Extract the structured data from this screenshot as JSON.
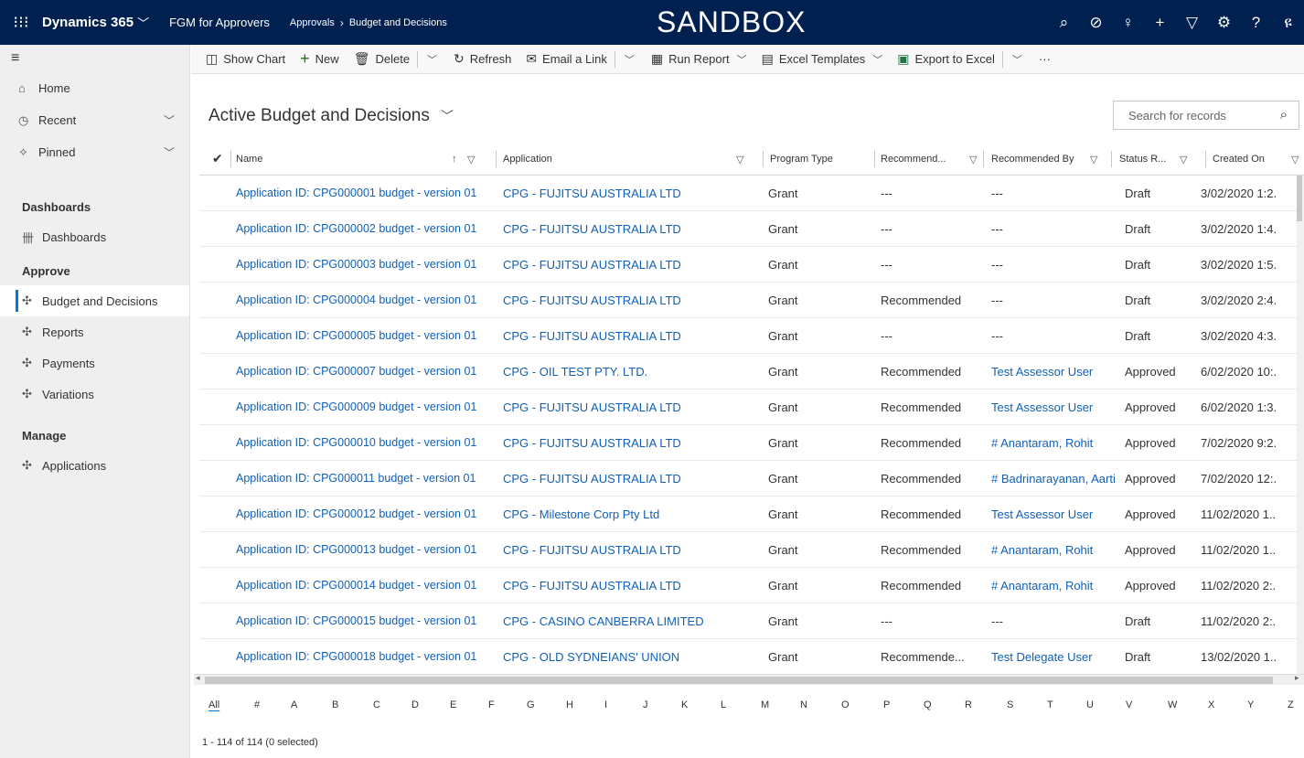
{
  "topbar": {
    "brand": "Dynamics 365",
    "app_name": "FGM for Approvers",
    "breadcrumb_parent": "Approvals",
    "breadcrumb_current": "Budget and Decisions",
    "environment": "SANDBOX"
  },
  "nav": {
    "home": "Home",
    "recent": "Recent",
    "pinned": "Pinned",
    "section_dashboards": "Dashboards",
    "dashboards": "Dashboards",
    "section_approve": "Approve",
    "budget_and_decisions": "Budget and Decisions",
    "reports": "Reports",
    "payments": "Payments",
    "variations": "Variations",
    "section_manage": "Manage",
    "applications": "Applications"
  },
  "commands": {
    "show_chart": "Show Chart",
    "new": "New",
    "delete": "Delete",
    "refresh": "Refresh",
    "email_link": "Email a Link",
    "run_report": "Run Report",
    "excel_templates": "Excel Templates",
    "export_excel": "Export to Excel",
    "more": "···"
  },
  "view": {
    "title": "Active Budget and Decisions",
    "search_placeholder": "Search for records"
  },
  "columns": {
    "name": "Name",
    "application": "Application",
    "program_type": "Program Type",
    "recommend": "Recommend...",
    "recommended_by": "Recommended By",
    "status": "Status R...",
    "created_on": "Created On"
  },
  "rows": [
    {
      "name": "Application ID: CPG000001 budget - version 01",
      "application": "CPG - FUJITSU AUSTRALIA LTD",
      "program_type": "Grant",
      "recommendation": "---",
      "recommended_by": "---",
      "status": "Draft",
      "created_on": "3/02/2020 1:2."
    },
    {
      "name": "Application ID: CPG000002 budget - version 01",
      "application": "CPG - FUJITSU AUSTRALIA LTD",
      "program_type": "Grant",
      "recommendation": "---",
      "recommended_by": "---",
      "status": "Draft",
      "created_on": "3/02/2020 1:4."
    },
    {
      "name": "Application ID: CPG000003 budget - version 01",
      "application": "CPG - FUJITSU AUSTRALIA LTD",
      "program_type": "Grant",
      "recommendation": "---",
      "recommended_by": "---",
      "status": "Draft",
      "created_on": "3/02/2020 1:5."
    },
    {
      "name": "Application ID: CPG000004 budget - version 01",
      "application": "CPG - FUJITSU AUSTRALIA LTD",
      "program_type": "Grant",
      "recommendation": "Recommended",
      "recommended_by": "---",
      "status": "Draft",
      "created_on": "3/02/2020 2:4."
    },
    {
      "name": "Application ID: CPG000005 budget - version 01",
      "application": "CPG - FUJITSU AUSTRALIA LTD",
      "program_type": "Grant",
      "recommendation": "---",
      "recommended_by": "---",
      "status": "Draft",
      "created_on": "3/02/2020 4:3."
    },
    {
      "name": "Application ID: CPG000007 budget - version 01",
      "application": "CPG - OIL TEST PTY. LTD.",
      "program_type": "Grant",
      "recommendation": "Recommended",
      "recommended_by": "Test Assessor User",
      "status": "Approved",
      "created_on": "6/02/2020 10:."
    },
    {
      "name": "Application ID: CPG000009 budget - version 01",
      "application": "CPG - FUJITSU AUSTRALIA LTD",
      "program_type": "Grant",
      "recommendation": "Recommended",
      "recommended_by": "Test Assessor User",
      "status": "Approved",
      "created_on": "6/02/2020 1:3."
    },
    {
      "name": "Application ID: CPG000010 budget - version 01",
      "application": "CPG - FUJITSU AUSTRALIA LTD",
      "program_type": "Grant",
      "recommendation": "Recommended",
      "recommended_by": "# Anantaram, Rohit",
      "status": "Approved",
      "created_on": "7/02/2020 9:2."
    },
    {
      "name": "Application ID: CPG000011 budget - version 01",
      "application": "CPG - FUJITSU AUSTRALIA LTD",
      "program_type": "Grant",
      "recommendation": "Recommended",
      "recommended_by": "# Badrinarayanan, Aarti",
      "status": "Approved",
      "created_on": "7/02/2020 12:."
    },
    {
      "name": "Application ID: CPG000012 budget - version 01",
      "application": "CPG - Milestone Corp Pty Ltd",
      "program_type": "Grant",
      "recommendation": "Recommended",
      "recommended_by": "Test Assessor User",
      "status": "Approved",
      "created_on": "11/02/2020 1.."
    },
    {
      "name": "Application ID: CPG000013 budget - version 01",
      "application": "CPG - FUJITSU AUSTRALIA LTD",
      "program_type": "Grant",
      "recommendation": "Recommended",
      "recommended_by": "# Anantaram, Rohit",
      "status": "Approved",
      "created_on": "11/02/2020 1.."
    },
    {
      "name": "Application ID: CPG000014 budget - version 01",
      "application": "CPG - FUJITSU AUSTRALIA LTD",
      "program_type": "Grant",
      "recommendation": "Recommended",
      "recommended_by": "# Anantaram, Rohit",
      "status": "Approved",
      "created_on": "11/02/2020 2:."
    },
    {
      "name": "Application ID: CPG000015 budget - version 01",
      "application": "CPG - CASINO CANBERRA LIMITED",
      "program_type": "Grant",
      "recommendation": "---",
      "recommended_by": "---",
      "status": "Draft",
      "created_on": "11/02/2020 2:."
    },
    {
      "name": "Application ID: CPG000018 budget - version 01",
      "application": "CPG - OLD SYDNEIANS' UNION",
      "program_type": "Grant",
      "recommendation": "Recommende...",
      "recommended_by": "Test Delegate User",
      "status": "Draft",
      "created_on": "13/02/2020 1.."
    }
  ],
  "alphabet": [
    "All",
    "#",
    "A",
    "B",
    "C",
    "D",
    "E",
    "F",
    "G",
    "H",
    "I",
    "J",
    "K",
    "L",
    "M",
    "N",
    "O",
    "P",
    "Q",
    "R",
    "S",
    "T",
    "U",
    "V",
    "W",
    "X",
    "Y",
    "Z"
  ],
  "footer": "1 - 114 of 114 (0 selected)"
}
